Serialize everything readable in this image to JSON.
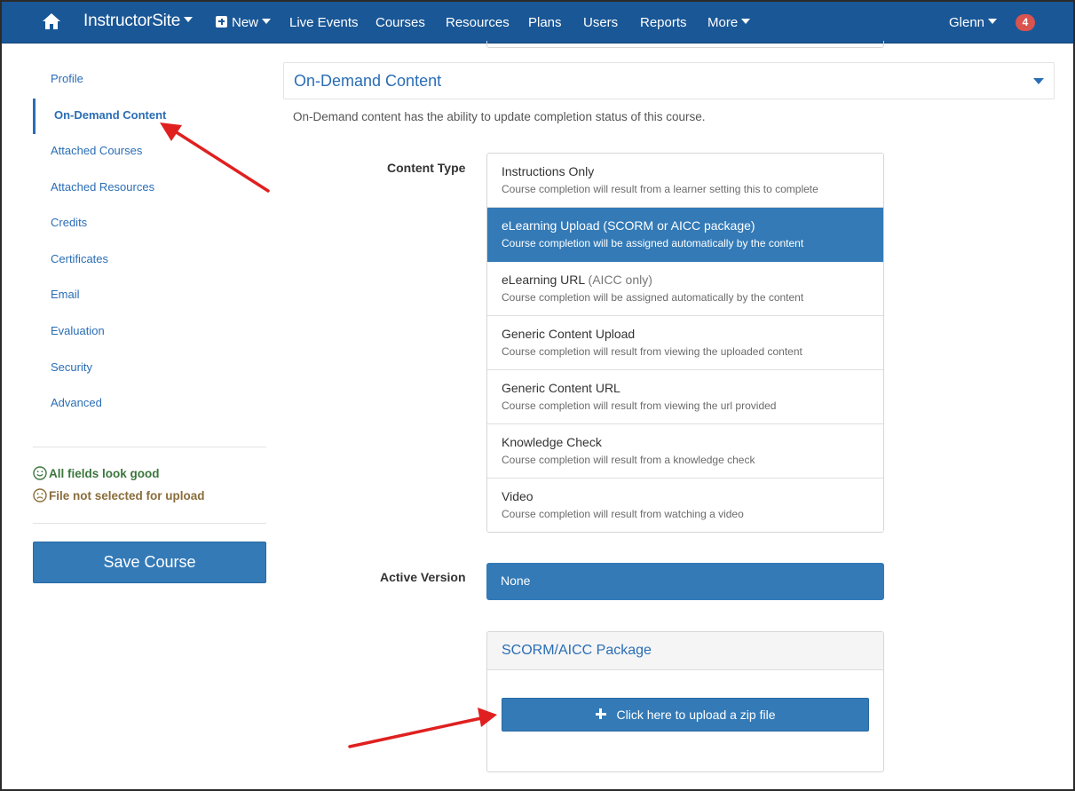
{
  "navbar": {
    "home_icon": "home-icon",
    "brand": "InstructorSite",
    "new_label": "New",
    "items": [
      "Live Events",
      "Courses",
      "Resources",
      "Plans",
      "Users",
      "Reports"
    ],
    "more_label": "More",
    "user_label": "Glenn",
    "notification_count": "4",
    "colors": {
      "bar": "#1a5796",
      "badge": "#d9534f"
    }
  },
  "sidebar": {
    "items": [
      {
        "label": "Profile",
        "active": false
      },
      {
        "label": "On-Demand Content",
        "active": true
      },
      {
        "label": "Attached Courses",
        "active": false
      },
      {
        "label": "Attached Resources",
        "active": false
      },
      {
        "label": "Credits",
        "active": false
      },
      {
        "label": "Certificates",
        "active": false
      },
      {
        "label": "Email",
        "active": false
      },
      {
        "label": "Evaluation",
        "active": false
      },
      {
        "label": "Security",
        "active": false
      },
      {
        "label": "Advanced",
        "active": false
      }
    ],
    "status_ok": {
      "icon": "smile-icon",
      "text": "All fields look good",
      "color": "#3c763d"
    },
    "status_warn": {
      "icon": "frown-icon",
      "text": "File not selected for upload",
      "color": "#8a6d3b"
    },
    "save_label": "Save Course"
  },
  "main": {
    "section_title": "On-Demand Content",
    "description": "On-Demand content has the ability to update completion status of this course.",
    "content_type": {
      "label": "Content Type",
      "selected_index": 1,
      "options": [
        {
          "title": "Instructions Only",
          "aux": "",
          "desc": "Course completion will result from a learner setting this to complete"
        },
        {
          "title": "eLearning Upload",
          "aux": "(SCORM or AICC package)",
          "desc": "Course completion will be assigned automatically by the content"
        },
        {
          "title": "eLearning URL",
          "aux": "(AICC only)",
          "desc": "Course completion will be assigned automatically by the content"
        },
        {
          "title": "Generic Content Upload",
          "aux": "",
          "desc": "Course completion will result from viewing the uploaded content"
        },
        {
          "title": "Generic Content URL",
          "aux": "",
          "desc": "Course completion will result from viewing the url provided"
        },
        {
          "title": "Knowledge Check",
          "aux": "",
          "desc": "Course completion will result from a knowledge check"
        },
        {
          "title": "Video",
          "aux": "",
          "desc": "Course completion will result from watching a video"
        }
      ]
    },
    "active_version": {
      "label": "Active Version",
      "value": "None"
    },
    "package": {
      "title": "SCORM/AICC Package",
      "upload_label": "Click here to upload a zip file",
      "upload_icon": "plus-icon"
    },
    "accent_color": "#337ab7",
    "annotation_arrow_color": "#e02020"
  }
}
